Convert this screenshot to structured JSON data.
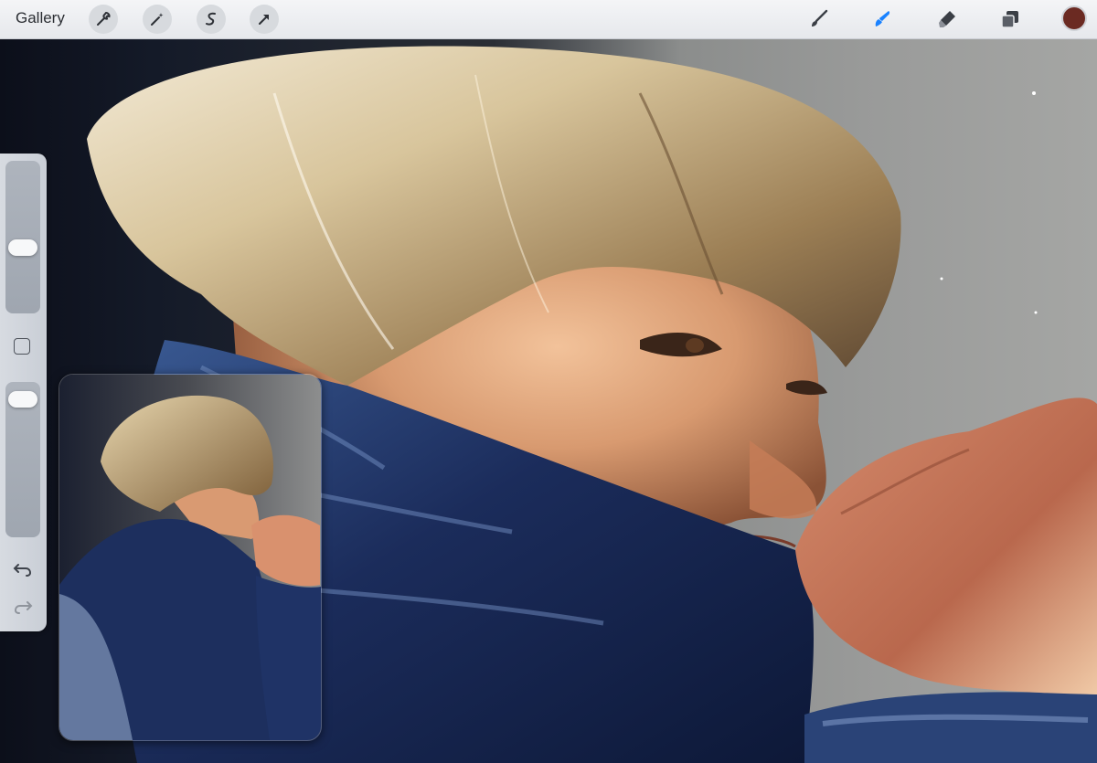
{
  "app": {
    "gallery_label": "Gallery"
  },
  "toolbar": {
    "left_tools": [
      "wrench-icon",
      "magic-wand-icon",
      "selection-s-icon",
      "move-arrow-icon"
    ],
    "right_tools": [
      "brush-icon",
      "smudge-icon",
      "eraser-icon",
      "layers-icon"
    ],
    "active_tool": "smudge-icon",
    "active_tool_color": "#1a82ff",
    "current_color": "#6b2a22"
  },
  "sidebar": {
    "brush_size_level": 0.42,
    "opacity_level": 0.95,
    "controls": [
      "brush-size-slider",
      "modify-button",
      "opacity-slider",
      "undo-icon",
      "redo-icon"
    ]
  },
  "reference_window": {
    "content": "photo-reference"
  }
}
